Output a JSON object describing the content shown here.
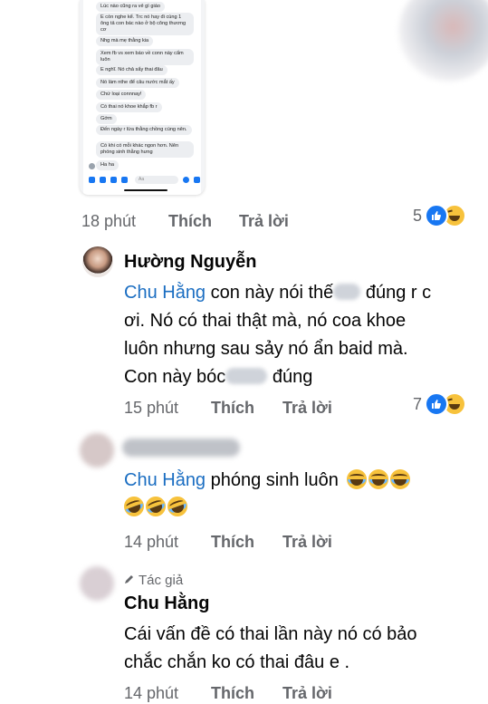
{
  "screenshot_card": {
    "messages": [
      "Lúc nào cũng ra vẻ gì giáo",
      "E còn nghe kể. Trc nó hay đi cùng 1 ông tả con bác nào ở bộ công thương cơ",
      "Nhg mà mẹ thằng kia",
      "Xem fb vs xem báo về conn này cẩm luôn",
      "E nghĩ. Nó chả sẩy thai đâu",
      "Nó làm nthe để câu nước mắt ấy",
      "Chứ loại connnay!",
      "Có thai nó khoe khắp fb r",
      "Gớm",
      "Đến ngày r lừa thằng chồng cùng nên.",
      "Có khi có mỗi khác ngon hơn. Nên phóng sinh thằng hưng",
      "Ha ha"
    ],
    "input_placeholder": "Aa"
  },
  "comments": [
    {
      "meta": {
        "time": "18 phút",
        "like": "Thích",
        "reply": "Trả lời"
      },
      "reaction_count": "5"
    },
    {
      "author": "Hường Nguyễn",
      "mention": "Chu Hằng",
      "line1_rest": " con này nói thế",
      "line1_end": " đúng r c",
      "line2": "ơi. Nó có thai thật mà, nó coa khoe",
      "line3": "luôn nhưng sau sảy nó ẩn baid mà.",
      "line4_start": "Con này bóc",
      "line4_end": " đúng",
      "meta": {
        "time": "15 phút",
        "like": "Thích",
        "reply": "Trả lời"
      },
      "reaction_count": "7"
    },
    {
      "mention": "Chu Hằng",
      "text": " phóng sinh luôn",
      "meta": {
        "time": "14 phút",
        "like": "Thích",
        "reply": "Trả lời"
      }
    },
    {
      "badge": "Tác giả",
      "author": "Chu Hằng",
      "line1": "Cái vấn đề có thai lần này nó có bảo",
      "line2": "chắc chắn ko có thai đâu e .",
      "meta": {
        "time": "14 phút",
        "like": "Thích",
        "reply": "Trả lời"
      }
    }
  ],
  "colors": {
    "mention": "#1b6ec2",
    "like": "#1877f2",
    "haha": "#f7c23c",
    "meta": "#65676b"
  }
}
